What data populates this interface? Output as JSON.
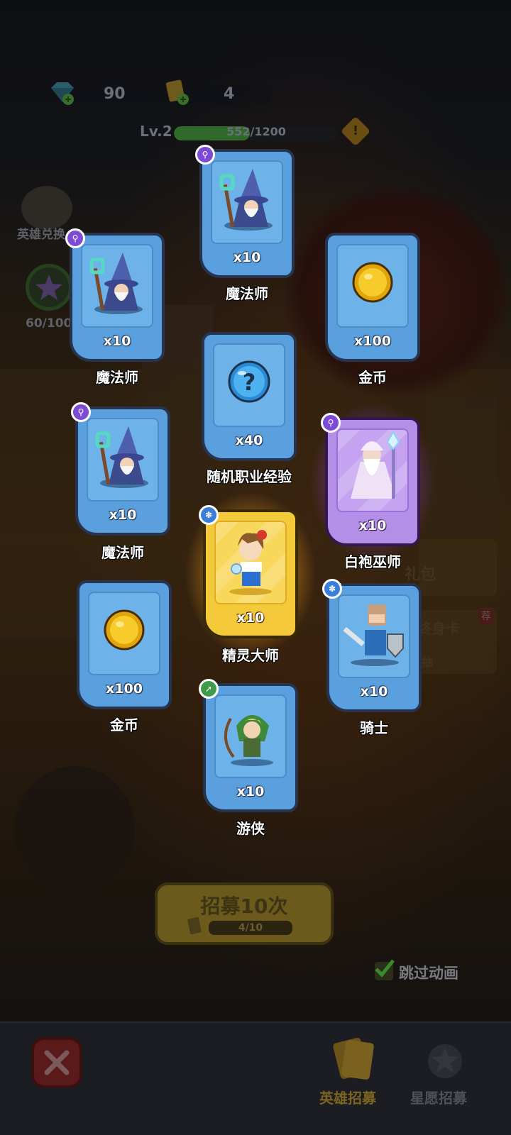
{
  "resources": {
    "gems": "90",
    "tickets": "4"
  },
  "level": {
    "label": "Lv.2",
    "xp_text": "552/1200",
    "xp_fraction": 0.46
  },
  "side": {
    "hero_exchange": "英雄兑换",
    "star_progress": "60/100"
  },
  "cards": [
    {
      "id": "wizard-top",
      "count": "x10",
      "label": "魔法师",
      "rarity": "blue",
      "badge": "purple",
      "art": "wizard-art"
    },
    {
      "id": "wizard-left-1",
      "count": "x10",
      "label": "魔法师",
      "rarity": "blue",
      "badge": "purple",
      "art": "wizard-art"
    },
    {
      "id": "gold-right-1",
      "count": "x100",
      "label": "金币",
      "rarity": "blue",
      "badge": "none",
      "art": "gold-coin-icon"
    },
    {
      "id": "random-exp",
      "count": "x40",
      "label": "随机职业经验",
      "rarity": "blue",
      "badge": "none",
      "art": "question-orb-icon"
    },
    {
      "id": "wizard-left-2",
      "count": "x10",
      "label": "魔法师",
      "rarity": "blue",
      "badge": "purple",
      "art": "wizard-art"
    },
    {
      "id": "white-robe",
      "count": "x10",
      "label": "白袍巫师",
      "rarity": "purple",
      "badge": "purple",
      "art": "white-robe-wizard-art"
    },
    {
      "id": "spirit-master",
      "count": "x10",
      "label": "精灵大师",
      "rarity": "gold",
      "badge": "blue",
      "art": "spirit-master-art"
    },
    {
      "id": "gold-left",
      "count": "x100",
      "label": "金币",
      "rarity": "blue",
      "badge": "none",
      "art": "gold-coin-icon"
    },
    {
      "id": "knight",
      "count": "x10",
      "label": "骑士",
      "rarity": "blue",
      "badge": "blue",
      "art": "knight-art"
    },
    {
      "id": "ranger",
      "count": "x10",
      "label": "游侠",
      "rarity": "blue",
      "badge": "green",
      "art": "ranger-art"
    }
  ],
  "recruit": {
    "label": "招募10次",
    "progress": "4/10"
  },
  "skip_animation": "跳过动画",
  "tabs": {
    "hero_recruit": "英雄招募",
    "star_recruit": "星愿招募"
  },
  "background_fragments": {
    "gift": "礼包",
    "lifetime_card": "终身卡",
    "recommend": "荐",
    "draw": "抽"
  }
}
